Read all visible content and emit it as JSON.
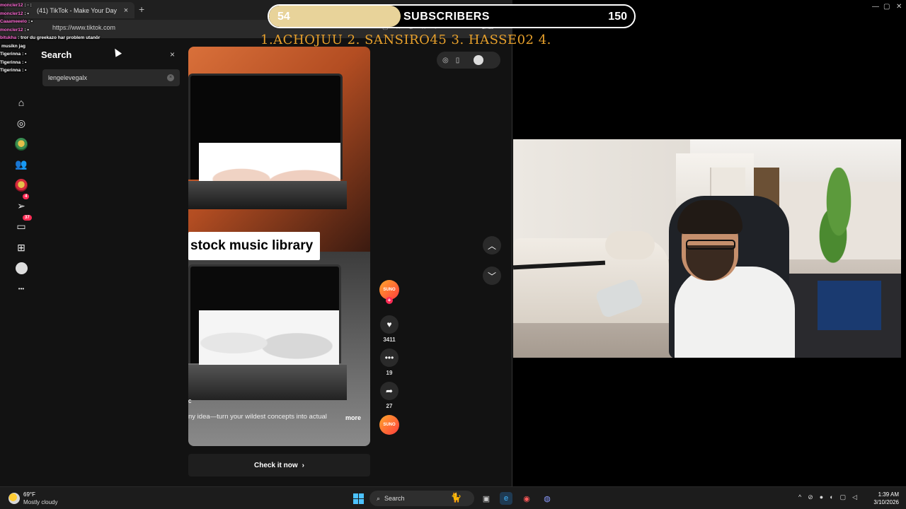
{
  "browser": {
    "tab_title": "(41) TikTok - Make Your Day",
    "tab_close": "×",
    "new_tab": "+",
    "url": "https://www.tiktok.com",
    "chat_button": "Chat"
  },
  "chat": {
    "messages": [
      {
        "user": "moncler12",
        "text": ": ◦ :"
      },
      {
        "user": "moncler12",
        "text": ": •"
      },
      {
        "user": "Caaameeelo",
        "text": ": •"
      },
      {
        "user": "moncler12",
        "text": ": •"
      },
      {
        "user": "bitukha",
        "text": ": tror du greekazo har problem utanör"
      },
      {
        "user": "",
        "text": "musikn jag"
      },
      {
        "user": "Tigerinna",
        "text": ": •"
      },
      {
        "user": "Tigerinna",
        "text": ": •"
      },
      {
        "user": "Tigerinna",
        "text": ": •"
      }
    ]
  },
  "sidebar": {
    "search_title": "Search",
    "search_close": "×",
    "search_value": "lengelevegalx",
    "badges": {
      "messages": "4",
      "inbox": "37"
    },
    "more": "•••"
  },
  "video": {
    "caption": "stock music library",
    "description": "ny idea—turn your wildest concepts into actual",
    "more": "more",
    "partial_letter": "c",
    "cta": "Check it now",
    "cta_arrow": "›",
    "author_avatar_text": "SUNO",
    "likes": "3411",
    "comments": "19",
    "shares": "27",
    "music_text": "SUNO"
  },
  "stream_overlay": {
    "sub_current": "54",
    "sub_label": "SUBSCRIBERS",
    "sub_goal": "150",
    "sub_progress": 0.36,
    "top_list": "1.ACHOJUU  2. SANSIRO45  3. HASSE02 4."
  },
  "taskbar": {
    "temp": "69°F",
    "weather": "Mostly cloudy",
    "search": "Search",
    "time": "1:39 AM",
    "date": "3/10/2026"
  },
  "colors": {
    "accent": "#fe2c55",
    "sub_fill": "#e8d39a",
    "top_list": "#e8a12c"
  }
}
